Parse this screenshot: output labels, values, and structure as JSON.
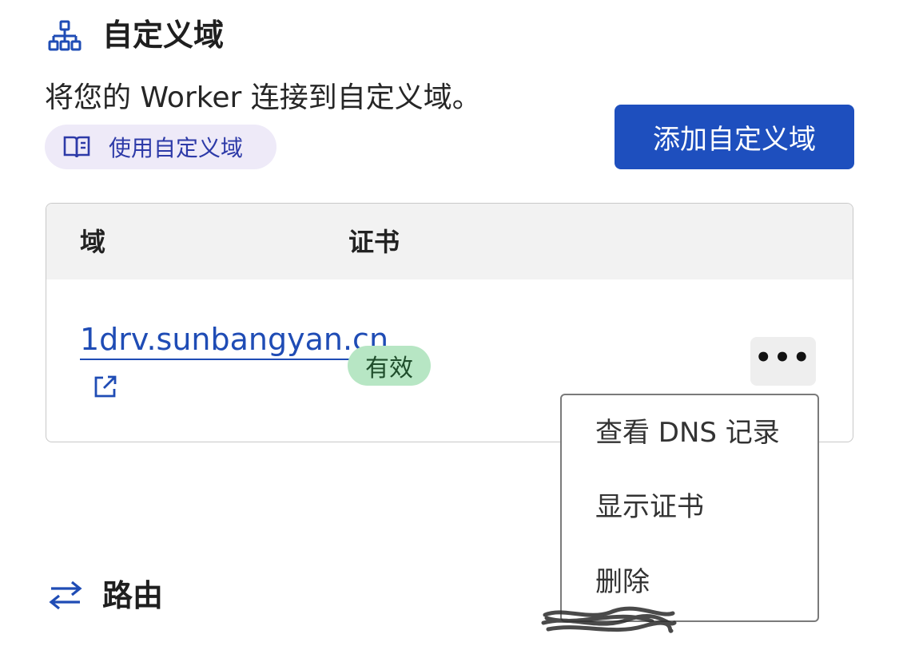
{
  "domains_section": {
    "heading": "自定义域",
    "icon": "network-tree-icon",
    "description": "将您的 Worker 连接到自定义域。",
    "docs_link_label": "使用自定义域",
    "docs_icon": "book-icon",
    "add_button_label": "添加自定义域"
  },
  "table": {
    "columns": [
      "域",
      "证书"
    ],
    "rows": [
      {
        "domain": "1drv.sunbangyan.cn",
        "certificate_status": "有效",
        "external_icon": "external-link-icon",
        "menu_icon": "more-horizontal-icon"
      }
    ]
  },
  "row_menu": {
    "items": [
      "查看 DNS 记录",
      "显示证书",
      "删除"
    ]
  },
  "routes_section": {
    "heading": "路由",
    "icon": "arrows-left-right-icon"
  },
  "colors": {
    "primary": "#1e4fbe",
    "link": "#1f4cb5",
    "badge_bg": "#b7e6c4",
    "pill_bg": "#eeeaf8"
  }
}
